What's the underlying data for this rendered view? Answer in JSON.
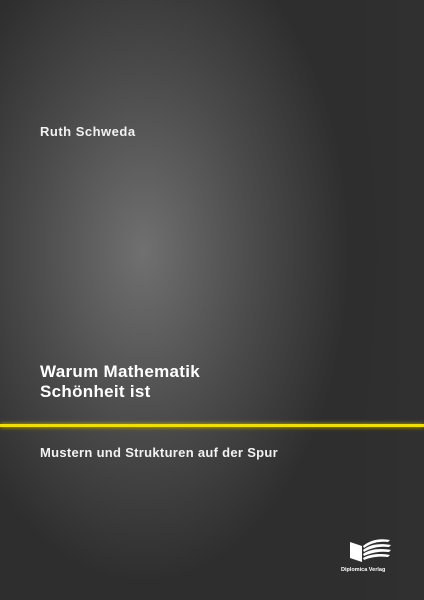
{
  "cover": {
    "author": "Ruth Schweda",
    "title_line1": "Warum Mathematik",
    "title_line2": "Schönheit ist",
    "subtitle": "Mustern und Strukturen auf der Spur",
    "publisher": "Diplomica Verlag"
  },
  "colors": {
    "background_dark": "#2a2a2a",
    "background_light": "#6e6e6e",
    "accent_rule": "#f0e000",
    "text": "#ffffff"
  },
  "icons": {
    "publisher_logo": "book-pages-logo-icon"
  }
}
